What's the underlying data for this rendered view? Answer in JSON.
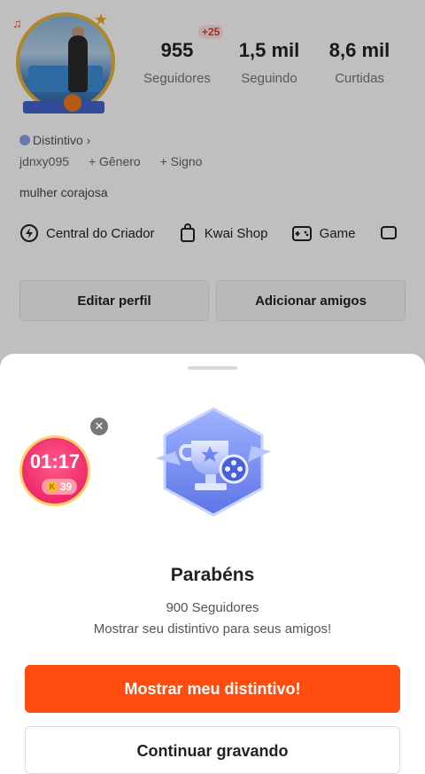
{
  "profile": {
    "stats": [
      {
        "value": "955",
        "label": "Seguidores"
      },
      {
        "value": "1,5 mil",
        "label": "Seguindo"
      },
      {
        "value": "8,6 mil",
        "label": "Curtidas"
      }
    ],
    "new_followers_badge": "+25",
    "distintivo_label": "Distintivo",
    "username": "jdnxy095",
    "gender_link": "+ Gênero",
    "sign_link": "+ Signo",
    "bio": "mulher  corajosa",
    "links": [
      {
        "label": "Central do Criador",
        "icon": "lightning-icon"
      },
      {
        "label": "Kwai Shop",
        "icon": "shopping-bag-icon"
      },
      {
        "label": "Game",
        "icon": "gamepad-icon"
      }
    ],
    "edit_button": "Editar perfil",
    "add_friends_button": "Adicionar amigos"
  },
  "timer": {
    "time": "01:17",
    "coins": "39"
  },
  "sheet": {
    "title": "Parabéns",
    "followers_line": "900 Seguidores",
    "description": "Mostrar seu distintivo para seus amigos!",
    "primary_button": "Mostrar meu distintivo!",
    "secondary_button": "Continuar gravando"
  },
  "colors": {
    "accent": "#ff4d0f",
    "badge_blue": "#6f86f0",
    "timer_pink": "#ee2a6a"
  }
}
